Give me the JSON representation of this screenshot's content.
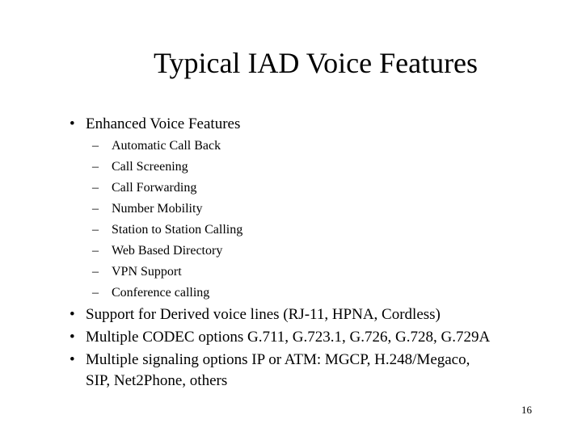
{
  "slide": {
    "title": "Typical IAD Voice Features",
    "bullet_glyph": "•",
    "sub_glyph": "–",
    "bullets": [
      {
        "text": "Enhanced Voice Features",
        "sub": [
          "Automatic Call Back",
          "Call Screening",
          "Call Forwarding",
          "Number Mobility",
          "Station to Station Calling",
          "Web Based Directory",
          "VPN Support",
          "Conference calling"
        ]
      },
      {
        "text": "Support for  Derived voice lines (RJ-11, HPNA, Cordless)"
      },
      {
        "text": "Multiple CODEC options G.711, G.723.1, G.726, G.728, G.729A"
      },
      {
        "text": "Multiple signaling options IP or ATM: MGCP, H.248/Megaco,",
        "continuation": "SIP, Net2Phone, others"
      }
    ],
    "page_number": "16"
  }
}
